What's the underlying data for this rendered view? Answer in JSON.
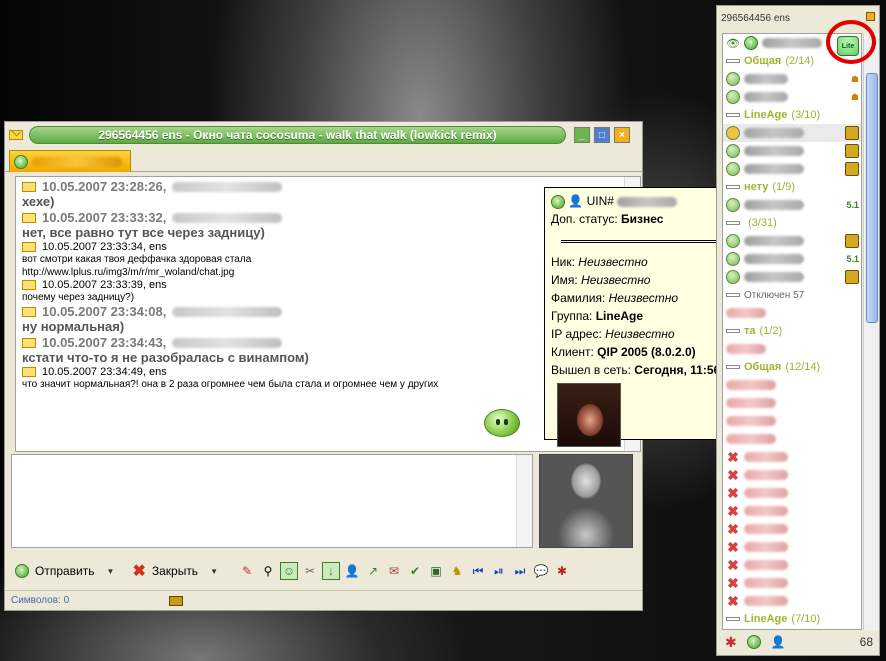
{
  "chat_window": {
    "title": "296564456 ens - Окно чата  cocosuma - walk that walk (lowkick remix)",
    "messages": [
      {
        "time": "10.05.2007 23:28:26,",
        "text": "хехе)",
        "style": "big"
      },
      {
        "time": "10.05.2007 23:33:32,",
        "text": "нет, все равно тут все через задницу)",
        "style": "big"
      },
      {
        "time": "10.05.2007 23:33:34, ens",
        "text": "вот смотри какая твоя деффачка здоровая стала\nhttp://www.lplus.ru/img3/m/r/mr_woland/chat.jpg",
        "style": "small"
      },
      {
        "time": "10.05.2007 23:33:39, ens",
        "text": "почему через задницу?)",
        "style": "small"
      },
      {
        "time": "10.05.2007 23:34:08,",
        "text": "ну нормальная)",
        "style": "big"
      },
      {
        "time": "10.05.2007 23:34:43,",
        "text": "кстати что-то я не разобралась с винампом)",
        "style": "big"
      },
      {
        "time": "10.05.2007 23:34:49, ens",
        "text": "что значит нормальная?! она в 2 раза огромнее чем была стала и огромнее чем у других",
        "style": "small"
      }
    ],
    "send_label": "Отправить",
    "close_label": "Закрыть",
    "status_chars": "Символов: 0"
  },
  "tooltip": {
    "uin_label": "UIN#",
    "extra_status_label": "Доп. статус:",
    "extra_status_value": "Бизнес",
    "nick_label": "Ник:",
    "nick_value": "Неизвестно",
    "name_label": "Имя:",
    "name_value": "Неизвестно",
    "surname_label": "Фамилия:",
    "surname_value": "Неизвестно",
    "group_label": "Группа:",
    "group_value": "LineAge",
    "ip_label": "IP адрес:",
    "ip_value": "Неизвестно",
    "client_label": "Клиент:",
    "client_value": "QIP 2005 (8.0.2.0)",
    "online_label": "Вышел в сеть:",
    "online_value": "Сегодня, 11:56"
  },
  "contact_list": {
    "title": "296564456 ens",
    "lite_badge": "Lite",
    "groups": [
      {
        "name": "Общая",
        "count": "(2/14)"
      },
      {
        "name": "LineAge",
        "count": "(3/10)"
      },
      {
        "name": "нету",
        "count": "(1/9)"
      },
      {
        "name": "",
        "count": "(3/31)"
      },
      {
        "name": "Отключен 57",
        "count": ""
      },
      {
        "name": "та",
        "count": "(1/2)"
      },
      {
        "name": "Общая",
        "count": "(12/14)"
      },
      {
        "name": "LineAge",
        "count": "(7/10)"
      }
    ],
    "online_count": "68",
    "version_tag": "5.1"
  }
}
